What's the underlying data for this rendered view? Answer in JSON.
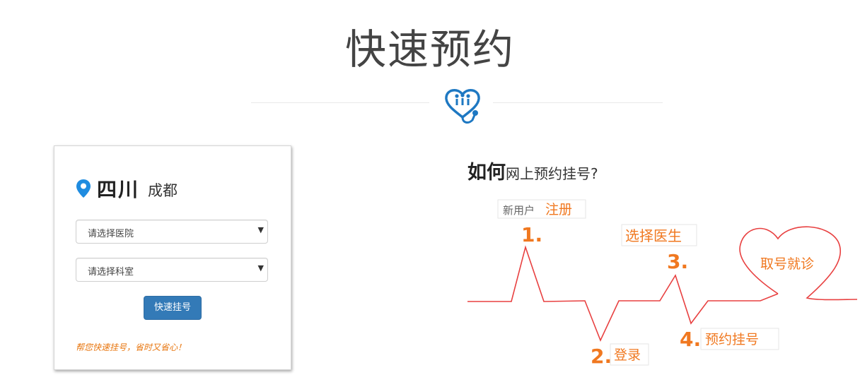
{
  "header": {
    "title": "快速预约",
    "logo_icon": "stethoscope-heart-icon",
    "accent": "#1e78c2"
  },
  "booking": {
    "province": "四川",
    "city": "成都",
    "location_icon": "map-pin-icon",
    "hospital_select": {
      "value": "请选择医院"
    },
    "department_select": {
      "value": "请选择科室"
    },
    "submit_label": "快速挂号",
    "slogan": "帮您快速挂号，省时又省心！",
    "button_color": "#337ab7",
    "slogan_color": "#e8760f"
  },
  "howto": {
    "title_bold": "如何",
    "title_rest": "网上预约挂号?",
    "steps": [
      {
        "number": "1.",
        "label_grey": "新用户",
        "label_orange": "注册"
      },
      {
        "number": "2.",
        "label_orange": "登录"
      },
      {
        "number": "3.",
        "label_orange": "选择医生"
      },
      {
        "number": "4.",
        "label_orange": "预约挂号"
      }
    ],
    "final": "取号就诊",
    "line_color": "#e84040",
    "step_color": "#f07820"
  }
}
